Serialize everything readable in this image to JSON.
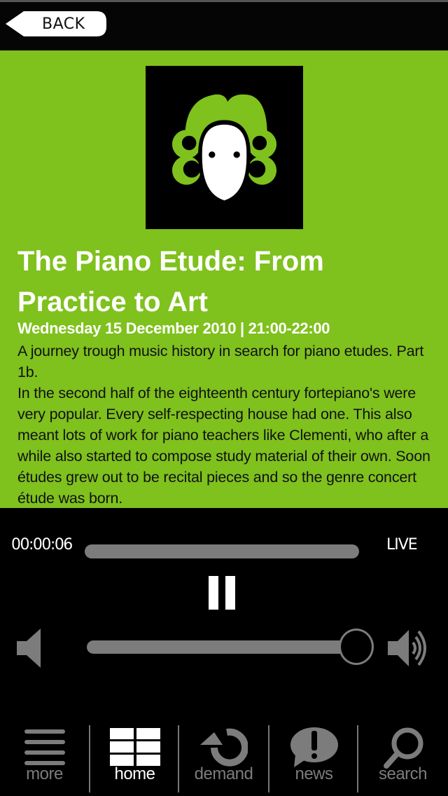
{
  "header": {
    "back_label": "BACK"
  },
  "program": {
    "logo_icon": "composer-wig-logo",
    "title": "The Piano Etude: From Practice to Art",
    "datetime": "Wednesday 15 December 2010 | 21:00-22:00",
    "description": [
      "A journey trough music history in search for piano etudes. Part 1b.",
      "In the second half of the eighteenth century fortepiano's were very popular. Every self-respecting house had one. This also meant lots of work for piano teachers like Clementi, who after a while also started to compose study material of their own. Soon études grew out to be recital pieces and so the genre concert étude was born."
    ]
  },
  "player": {
    "elapsed": "00:00:06",
    "live_label": "LIVE",
    "progress_fraction": 0.0,
    "state": "playing",
    "volume_fraction": 1.0,
    "colors": {
      "accent": "#7fc11d",
      "track": "#7c7c7c"
    }
  },
  "tabbar": {
    "items": [
      {
        "label": "more",
        "icon": "menu-icon",
        "active": false
      },
      {
        "label": "home",
        "icon": "grid-icon",
        "active": true
      },
      {
        "label": "demand",
        "icon": "replay-icon",
        "active": false
      },
      {
        "label": "news",
        "icon": "alert-bubble-icon",
        "active": false
      },
      {
        "label": "search",
        "icon": "search-icon",
        "active": false
      }
    ]
  }
}
